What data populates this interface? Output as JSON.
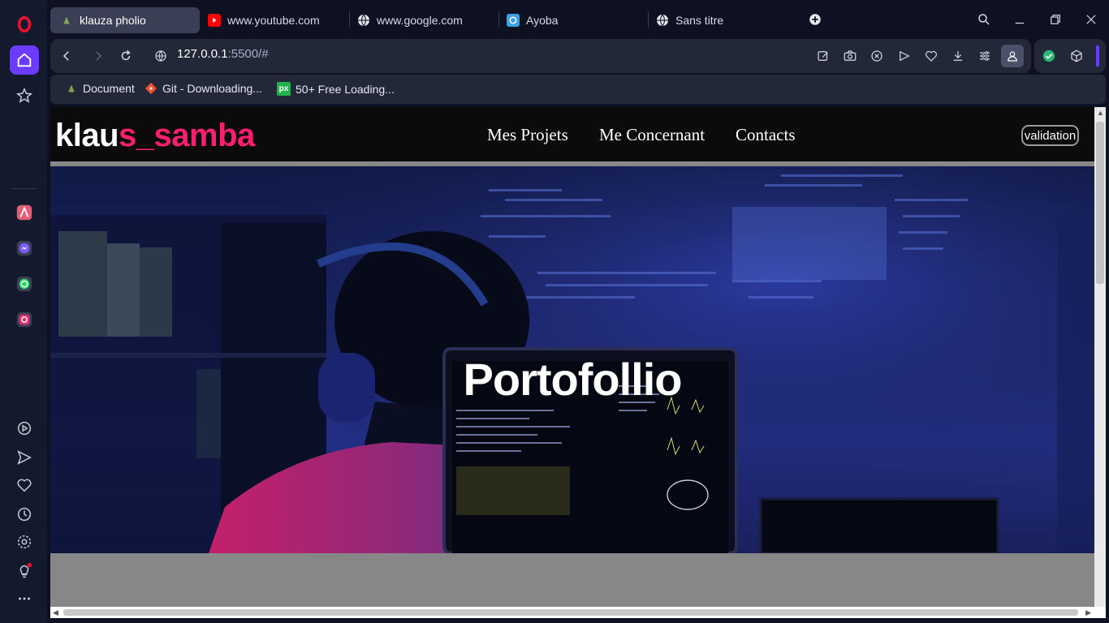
{
  "tabs": [
    {
      "label": "klauza pholio",
      "active": true,
      "favicon": "generic-favicon"
    },
    {
      "label": "www.youtube.com",
      "active": false,
      "favicon": "youtube-icon"
    },
    {
      "label": "www.google.com",
      "active": false,
      "favicon": "globe-icon"
    },
    {
      "label": "Ayoba",
      "active": false,
      "favicon": "ayoba-icon"
    },
    {
      "label": "Sans titre",
      "active": false,
      "favicon": "globe-icon"
    }
  ],
  "address": {
    "host": "127.0.0.1",
    "path": ":5500/#"
  },
  "bookmarks": [
    {
      "label": "Document",
      "favicon": "document-favicon"
    },
    {
      "label": "Git - Downloading...",
      "favicon": "git-icon"
    },
    {
      "label": "50+ Free Loading...",
      "favicon": "px-icon"
    }
  ],
  "site": {
    "logo_part1": "klau",
    "logo_part2": "s_samba",
    "nav": [
      "Mes Projets",
      "Me Concernant",
      "Contacts"
    ],
    "button": "validation",
    "hero_title": "Portofollio"
  },
  "colors": {
    "accent": "#ff1f6e",
    "opera_purple": "#6b3cff",
    "opera_red": "#e3142d"
  }
}
